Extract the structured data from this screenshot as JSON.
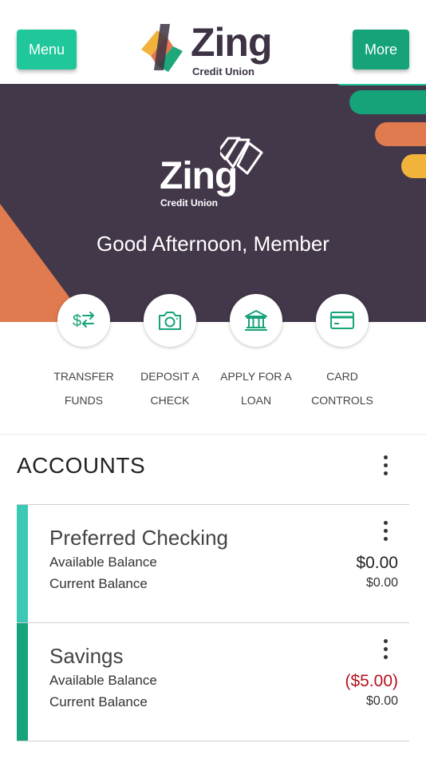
{
  "header": {
    "menu_label": "Menu",
    "more_label": "More",
    "logo_word": "Zing",
    "logo_sub": "Credit Union"
  },
  "hero": {
    "logo_word": "Zing",
    "logo_sub": "Credit Union",
    "greeting": "Good Afternoon, Member"
  },
  "actions": [
    {
      "line1": "TRANSFER",
      "line2": "FUNDS",
      "icon": "transfer-icon"
    },
    {
      "line1": "DEPOSIT A",
      "line2": "CHECK",
      "icon": "camera-icon"
    },
    {
      "line1": "APPLY FOR A",
      "line2": "LOAN",
      "icon": "bank-icon"
    },
    {
      "line1": "CARD",
      "line2": "CONTROLS",
      "icon": "card-icon"
    }
  ],
  "accounts": {
    "title": "ACCOUNTS",
    "items": [
      {
        "name": "Preferred Checking",
        "available_label": "Available Balance",
        "current_label": "Current Balance",
        "available": "$0.00",
        "current": "$0.00",
        "accent": "#3cc8b4"
      },
      {
        "name": "Savings",
        "available_label": "Available Balance",
        "current_label": "Current Balance",
        "available": "($5.00)",
        "current": "$0.00",
        "accent": "#16a37a"
      }
    ]
  },
  "colors": {
    "brand_green": "#16a37a",
    "menu_green": "#1fc79a",
    "hero_bg": "#43374a",
    "orange": "#e07a4f",
    "yellow": "#f2b33d",
    "negative": "#b3121f"
  }
}
